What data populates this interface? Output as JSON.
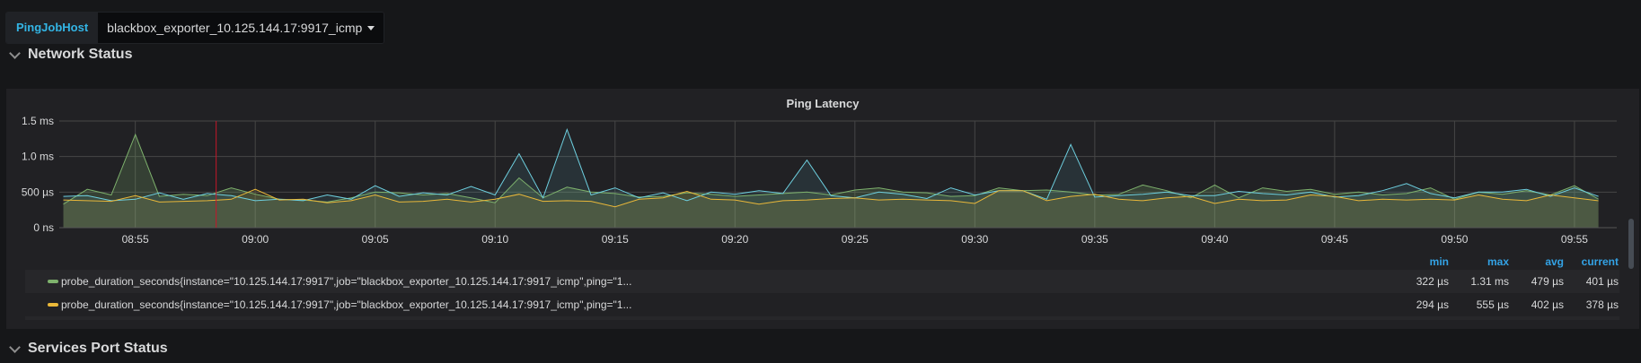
{
  "variables": {
    "label": "PingJobHost",
    "value": "blackbox_exporter_10.125.144.17:9917_icmp"
  },
  "rows": [
    {
      "title": "Network Status"
    },
    {
      "title": "Services Port Status"
    }
  ],
  "panel": {
    "title": "Ping Latency"
  },
  "legend": {
    "headers": {
      "min": "min",
      "max": "max",
      "avg": "avg",
      "current": "current"
    },
    "items": [
      {
        "name": "probe_duration_seconds{instance=\"10.125.144.17:9917\",job=\"blackbox_exporter_10.125.144.17:9917_icmp\",ping=\"1...",
        "color": "#7eb26d",
        "min": "322 µs",
        "max": "1.31 ms",
        "avg": "479 µs",
        "current": "401 µs"
      },
      {
        "name": "probe_duration_seconds{instance=\"10.125.144.17:9917\",job=\"blackbox_exporter_10.125.144.17:9917_icmp\",ping=\"1...",
        "color": "#eab839",
        "min": "294 µs",
        "max": "555 µs",
        "avg": "402 µs",
        "current": "378 µs"
      }
    ]
  },
  "chart_data": {
    "type": "line",
    "title": "Ping Latency",
    "x_start": "08:52",
    "x_step_minutes": 1,
    "xlim_minutes_after_0850": [
      1.83,
      66.5
    ],
    "xticks": [
      "08:55",
      "09:00",
      "09:05",
      "09:10",
      "09:15",
      "09:20",
      "09:25",
      "09:30",
      "09:35",
      "09:40",
      "09:45",
      "09:50",
      "09:55"
    ],
    "xtick_minutes_after_0850": [
      5,
      10,
      15,
      20,
      25,
      30,
      35,
      40,
      45,
      50,
      55,
      60,
      65
    ],
    "yticks": [
      {
        "v": 0,
        "label": "0 ns"
      },
      {
        "v": 500,
        "label": "500 µs"
      },
      {
        "v": 1000,
        "label": "1.0 ms"
      },
      {
        "v": 1500,
        "label": "1.5 ms"
      }
    ],
    "ylim_us": [
      0,
      1500
    ],
    "grid": true,
    "annotations": [
      {
        "minutes_after_0850": 8.37,
        "color": "#c4162a"
      }
    ],
    "series": [
      {
        "name": "green",
        "color": "#7eb26d",
        "values": [
          330,
          540,
          460,
          1310,
          440,
          470,
          450,
          560,
          470,
          400,
          390,
          360,
          420,
          500,
          490,
          460,
          480,
          420,
          350,
          700,
          420,
          570,
          500,
          480,
          430,
          440,
          490,
          470,
          440,
          460,
          480,
          500,
          460,
          530,
          560,
          500,
          490,
          440,
          450,
          560,
          520,
          530,
          500,
          460,
          470,
          600,
          520,
          420,
          600,
          420,
          560,
          510,
          540,
          470,
          500,
          460,
          480,
          560,
          400,
          500,
          470,
          520,
          460,
          590,
          401
        ]
      },
      {
        "name": "blue",
        "color": "#6ed0e0",
        "values": [
          440,
          450,
          380,
          400,
          490,
          400,
          480,
          450,
          380,
          400,
          380,
          460,
          400,
          590,
          440,
          490,
          460,
          580,
          460,
          1040,
          420,
          1380,
          460,
          560,
          420,
          490,
          380,
          500,
          470,
          520,
          480,
          950,
          450,
          420,
          500,
          470,
          410,
          560,
          460,
          520,
          520,
          400,
          1170,
          430,
          450,
          470,
          500,
          450,
          450,
          510,
          480,
          460,
          500,
          430,
          450,
          520,
          620,
          480,
          420,
          500,
          500,
          540,
          440,
          560,
          440
        ]
      },
      {
        "name": "yellow",
        "color": "#eab839",
        "values": [
          390,
          380,
          370,
          450,
          360,
          370,
          380,
          400,
          540,
          390,
          400,
          350,
          380,
          460,
          360,
          370,
          400,
          360,
          400,
          470,
          370,
          380,
          370,
          294,
          400,
          420,
          510,
          400,
          390,
          330,
          380,
          390,
          410,
          420,
          390,
          400,
          390,
          380,
          340,
          520,
          520,
          380,
          440,
          470,
          400,
          380,
          420,
          440,
          340,
          400,
          380,
          390,
          460,
          440,
          380,
          400,
          390,
          400,
          390,
          460,
          400,
          380,
          460,
          420,
          378
        ]
      }
    ]
  }
}
